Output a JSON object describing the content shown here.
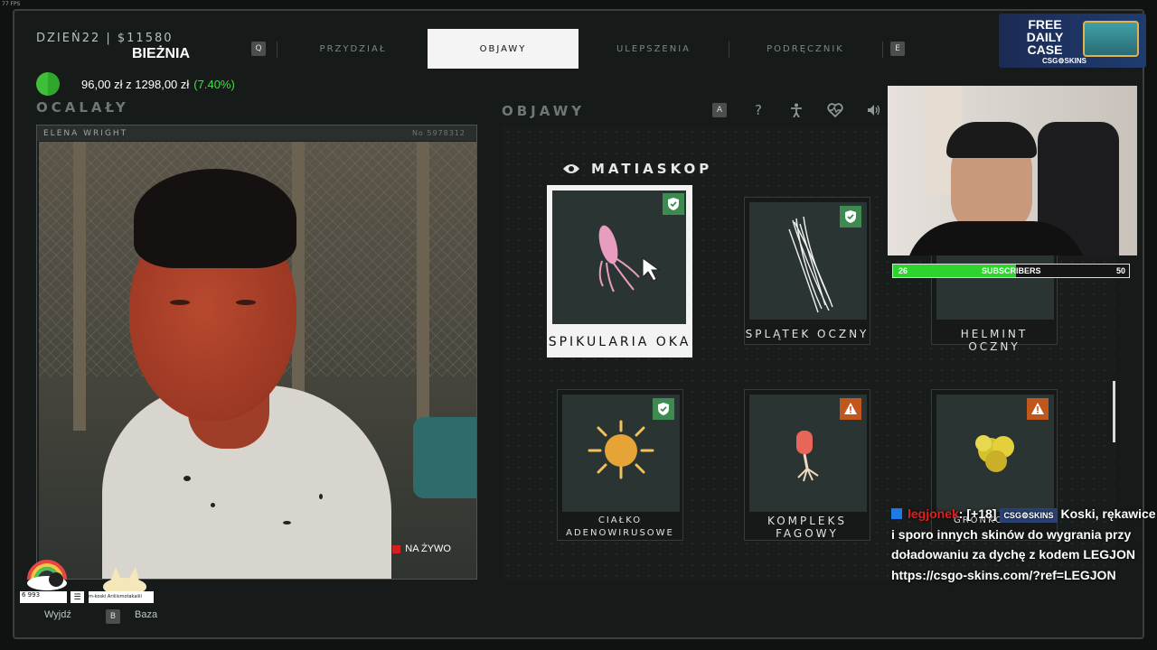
{
  "overlay": {
    "fps": "77 FPS"
  },
  "header": {
    "day": "DZIEŃ22 | $11580",
    "treadmill": "BIEŻNIA",
    "donation": {
      "amount": "96,00 zł",
      "sep": "z",
      "goal": "1298,00 zł",
      "percent": "(7.40%)"
    }
  },
  "tabs": {
    "left_key": "Q",
    "right_key": "E",
    "items": [
      {
        "label": "PRZYDZIAŁ"
      },
      {
        "label": "OBJAWY"
      },
      {
        "label": "ULEPSZENIA"
      },
      {
        "label": "PODRĘCZNIK"
      }
    ],
    "active": "OBJAWY"
  },
  "survivor": {
    "section_title": "OCALAŁY",
    "name": "ELENA WRIGHT",
    "number": "No 5978312",
    "live_label": "NA ŻYWO"
  },
  "symptoms": {
    "section_title": "OBJAWY",
    "toolbar": {
      "key": "A",
      "icons": [
        "question-icon",
        "body-icon",
        "heart-icon",
        "speaker-icon"
      ]
    },
    "scope_title": "MATIASKOP",
    "cards": [
      {
        "name": "SPIKULARIA OKA",
        "status": "ok",
        "selected": true
      },
      {
        "name": "SPLĄTEK OCZNY",
        "status": "ok",
        "selected": false
      },
      {
        "name": "HELMINT OCZNY",
        "status": "none",
        "selected": false
      },
      {
        "name_line1": "CIAŁKO",
        "name_line2": "ADENOWIRUSOWE",
        "status": "ok",
        "selected": false
      },
      {
        "name_line1": "KOMPLEKS",
        "name_line2": "FAGOWY",
        "status": "warn",
        "selected": false
      },
      {
        "name_line1": "GRONKOWIEC",
        "name_line2": "",
        "status": "warn",
        "selected": false
      }
    ]
  },
  "footer": {
    "exit_label": "Wyjdź",
    "base_key": "B",
    "base_label": "Baza",
    "counter": "6 993",
    "ticker": "m-koski Ariiiismotakaiiii"
  },
  "stream": {
    "subscribers": {
      "label": "SUBSCRIBERS",
      "current": "26",
      "goal": "50",
      "fraction": 0.52
    },
    "promo": {
      "line1": "FREE",
      "line2": "DAILY",
      "line3": "CASE",
      "brand": "CSG⚙SKINS"
    },
    "chat": {
      "user": "legjonek",
      "badge": "[+18]",
      "brand": "CSG⚙SKINS",
      "message": "Koski, rękawice i sporo innych skinów do wygrania przy doładowaniu za dychę z kodem LEGJON https://csgo-skins.com/?ref=LEGJON"
    }
  }
}
